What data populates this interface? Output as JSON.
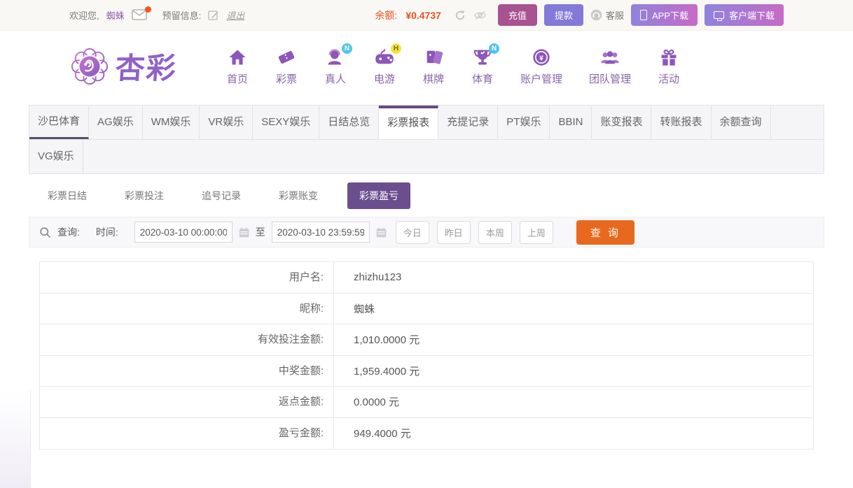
{
  "topbar": {
    "welcome_prefix": "欢迎您,",
    "username": "蜘蛛",
    "reserved_info_label": "预留信息:",
    "logout_label": "退出",
    "balance_label": "余额:",
    "balance_value": "¥0.4737",
    "recharge_label": "充值",
    "withdraw_label": "提款",
    "service_label": "客服",
    "app_download_label": "APP下载",
    "client_download_label": "客户端下载"
  },
  "header": {
    "logo_text": "杏彩",
    "nav": [
      {
        "label": "首页",
        "icon": "home-icon",
        "badge": ""
      },
      {
        "label": "彩票",
        "icon": "ticket-icon",
        "badge": ""
      },
      {
        "label": "真人",
        "icon": "live-person-icon",
        "badge": "N"
      },
      {
        "label": "电游",
        "icon": "gamepad-icon",
        "badge": "H"
      },
      {
        "label": "棋牌",
        "icon": "cards-icon",
        "badge": ""
      },
      {
        "label": "体育",
        "icon": "trophy-icon",
        "badge": "N"
      },
      {
        "label": "账户管理",
        "icon": "coin-yuan-icon",
        "badge": ""
      },
      {
        "label": "团队管理",
        "icon": "team-icon",
        "badge": ""
      },
      {
        "label": "活动",
        "icon": "gift-icon",
        "badge": ""
      }
    ]
  },
  "tabs": {
    "row1": [
      "沙巴体育",
      "AG娱乐",
      "WM娱乐",
      "VR娱乐",
      "SEXY娱乐",
      "日结总览",
      "彩票报表",
      "充提记录",
      "PT娱乐",
      "BBIN",
      "账变报表",
      "转账报表",
      "余额查询"
    ],
    "row2": [
      "VG娱乐"
    ],
    "active_tab": "彩票报表"
  },
  "subtabs": {
    "items": [
      "彩票日结",
      "彩票投注",
      "追号记录",
      "彩票账变",
      "彩票盈亏"
    ],
    "active_subtab": "彩票盈亏"
  },
  "search": {
    "query_label": "查询:",
    "time_label": "时间:",
    "start_time": "2020-03-10 00:00:00",
    "to_label": "至",
    "end_time": "2020-03-10 23:59:59",
    "quick_buttons": [
      "今日",
      "昨日",
      "本周",
      "上周"
    ],
    "submit_label": "查 询"
  },
  "report": {
    "rows": [
      {
        "label": "用户名:",
        "value": "zhizhu123"
      },
      {
        "label": "昵称:",
        "value": "蜘蛛"
      },
      {
        "label": "有效投注金额:",
        "value": "1,010.0000 元"
      },
      {
        "label": "中奖金额:",
        "value": "1,959.4000 元"
      },
      {
        "label": "返点金额:",
        "value": "0.0000 元"
      },
      {
        "label": "盈亏金额:",
        "value": "949.4000 元"
      }
    ]
  },
  "colors": {
    "accent_purple": "#6b4e8e",
    "recharge_plum": "#a8538f",
    "withdraw_periwinkle": "#8379d8",
    "balance_orange": "#e84f1d",
    "submit_orange": "#e8691e",
    "badge_cyan": "#4fc6ea",
    "badge_yellow": "#f4e23e"
  }
}
